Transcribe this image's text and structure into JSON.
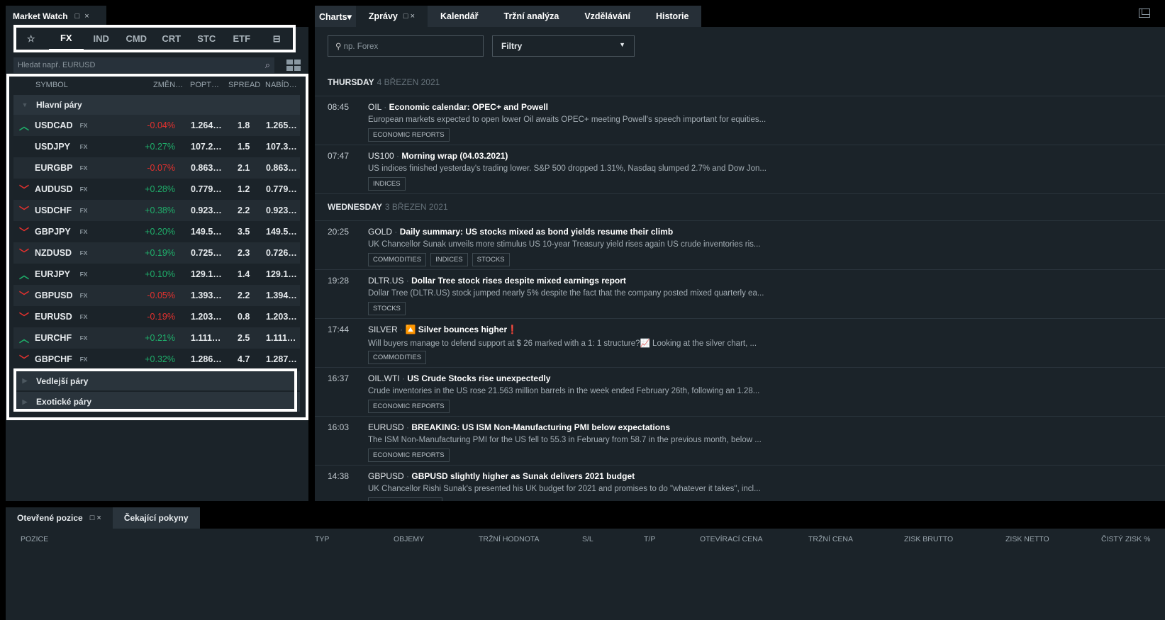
{
  "market_watch": {
    "title": "Market Watch",
    "ctl": "□ ×",
    "categories": [
      "☆",
      "FX",
      "IND",
      "CMD",
      "CRT",
      "STC",
      "ETF",
      "⊟"
    ],
    "active_category": "FX",
    "search_placeholder": "Hledat např. EURUSD",
    "columns": {
      "symbol": "SYMBOL",
      "change": "ZMĚN…",
      "bid": "POPT…",
      "spread": "SPREAD",
      "ask": "NABÍD…"
    },
    "groups": [
      "Hlavní páry",
      "Vedlejší páry",
      "Exotické páry"
    ],
    "rows": [
      {
        "symbol": "USDCAD",
        "tag": "FX",
        "trend": "up",
        "change": "-0.04%",
        "dir": "down",
        "bid": "1.264…",
        "spread": "1.8",
        "ask": "1.265…"
      },
      {
        "symbol": "USDJPY",
        "tag": "FX",
        "trend": "",
        "change": "+0.27%",
        "dir": "up",
        "bid": "107.2…",
        "spread": "1.5",
        "ask": "107.3…"
      },
      {
        "symbol": "EURGBP",
        "tag": "FX",
        "trend": "",
        "change": "-0.07%",
        "dir": "down",
        "bid": "0.863…",
        "spread": "2.1",
        "ask": "0.863…"
      },
      {
        "symbol": "AUDUSD",
        "tag": "FX",
        "trend": "down",
        "change": "+0.28%",
        "dir": "up",
        "bid": "0.779…",
        "spread": "1.2",
        "ask": "0.779…"
      },
      {
        "symbol": "USDCHF",
        "tag": "FX",
        "trend": "down",
        "change": "+0.38%",
        "dir": "up",
        "bid": "0.923…",
        "spread": "2.2",
        "ask": "0.923…"
      },
      {
        "symbol": "GBPJPY",
        "tag": "FX",
        "trend": "down",
        "change": "+0.20%",
        "dir": "up",
        "bid": "149.5…",
        "spread": "3.5",
        "ask": "149.5…"
      },
      {
        "symbol": "NZDUSD",
        "tag": "FX",
        "trend": "down",
        "change": "+0.19%",
        "dir": "up",
        "bid": "0.725…",
        "spread": "2.3",
        "ask": "0.726…"
      },
      {
        "symbol": "EURJPY",
        "tag": "FX",
        "trend": "up",
        "change": "+0.10%",
        "dir": "up",
        "bid": "129.1…",
        "spread": "1.4",
        "ask": "129.1…"
      },
      {
        "symbol": "GBPUSD",
        "tag": "FX",
        "trend": "down",
        "change": "-0.05%",
        "dir": "down",
        "bid": "1.393…",
        "spread": "2.2",
        "ask": "1.394…"
      },
      {
        "symbol": "EURUSD",
        "tag": "FX",
        "trend": "down",
        "change": "-0.19%",
        "dir": "down",
        "bid": "1.203…",
        "spread": "0.8",
        "ask": "1.203…"
      },
      {
        "symbol": "EURCHF",
        "tag": "FX",
        "trend": "up",
        "change": "+0.21%",
        "dir": "up",
        "bid": "1.111…",
        "spread": "2.5",
        "ask": "1.111…"
      },
      {
        "symbol": "GBPCHF",
        "tag": "FX",
        "trend": "down",
        "change": "+0.32%",
        "dir": "up",
        "bid": "1.286…",
        "spread": "4.7",
        "ask": "1.287…"
      }
    ]
  },
  "center": {
    "tabs": [
      "Charts▾",
      "Zprávy",
      "Kalendář",
      "Tržní analýza",
      "Vzdělávání",
      "Historie"
    ],
    "active_tab": "Zprávy",
    "ctl": "□ ×",
    "search_placeholder": "np. Forex",
    "filter_label": "Filtry",
    "days": [
      {
        "day": "THURSDAY",
        "date": "4 BŘEZEN 2021",
        "items": [
          {
            "time": "08:45",
            "symbol": "OIL",
            "headline": "Economic calendar: OPEC+ and Powell",
            "desc": "European markets expected to open lower Oil awaits OPEC+ meeting Powell's speech important for equities...",
            "tags": [
              "ECONOMIC REPORTS"
            ]
          },
          {
            "time": "07:47",
            "symbol": "US100",
            "headline": "Morning wrap (04.03.2021)",
            "desc": "US indices finished yesterday's trading lower. S&P 500 dropped 1.31%, Nasdaq slumped 2.7% and Dow Jon...",
            "tags": [
              "INDICES"
            ]
          }
        ]
      },
      {
        "day": "WEDNESDAY",
        "date": "3 BŘEZEN 2021",
        "items": [
          {
            "time": "20:25",
            "symbol": "GOLD",
            "headline": "Daily summary: US stocks mixed as bond yields resume their climb",
            "desc": "UK Chancellor Sunak unveils more stimulus US 10-year Treasury yield rises again US crude inventories ris...",
            "tags": [
              "COMMODITIES",
              "INDICES",
              "STOCKS"
            ]
          },
          {
            "time": "19:28",
            "symbol": "DLTR.US",
            "headline": "Dollar Tree stock rises despite mixed earnings report",
            "desc": "Dollar Tree (DLTR.US) stock jumped nearly 5% despite the fact that the company posted mixed quarterly ea...",
            "tags": [
              "STOCKS"
            ]
          },
          {
            "time": "17:44",
            "symbol": "SILVER",
            "headline": "🔼 Silver bounces higher❗",
            "desc": "Will buyers manage to defend support at $ 26 marked with a 1: 1 structure?📈 Looking at the silver chart, ...",
            "tags": [
              "COMMODITIES"
            ]
          },
          {
            "time": "16:37",
            "symbol": "OIL.WTI",
            "headline": "US Crude Stocks rise unexpectedly",
            "desc": "Crude inventories in the US rose 21.563 million barrels in the week ended February 26th, following an 1.28...",
            "tags": [
              "ECONOMIC REPORTS"
            ]
          },
          {
            "time": "16:03",
            "symbol": "EURUSD",
            "headline": "BREAKING: US ISM Non-Manufacturing PMI below expectations",
            "desc": "The ISM Non-Manufacturing PMI for the US fell to 55.3 in February from 58.7 in the previous month, below ...",
            "tags": [
              "ECONOMIC REPORTS"
            ]
          },
          {
            "time": "14:38",
            "symbol": "GBPUSD",
            "headline": "GBPUSD slightly higher as Sunak delivers 2021 budget",
            "desc": "UK Chancellor Rishi Sunak's presented his UK budget for 2021 and promises to do \"whatever it takes\", incl...",
            "tags": [
              ""
            ]
          }
        ]
      }
    ]
  },
  "bottom": {
    "tabs": [
      "Otevřené pozice",
      "Čekající pokyny"
    ],
    "ctl": "□ ×",
    "columns": [
      "POZICE",
      "TYP",
      "OBJEMY",
      "TRŽNÍ HODNOTA",
      "S/L",
      "T/P",
      "OTEVÍRACÍ CENA",
      "TRŽNÍ CENA",
      "ZISK BRUTTO",
      "ZISK NETTO",
      "ČISTÝ ZISK %"
    ]
  },
  "colors": {
    "up": "#1fae6a",
    "down": "#e5312e",
    "panel": "#1b2329"
  }
}
